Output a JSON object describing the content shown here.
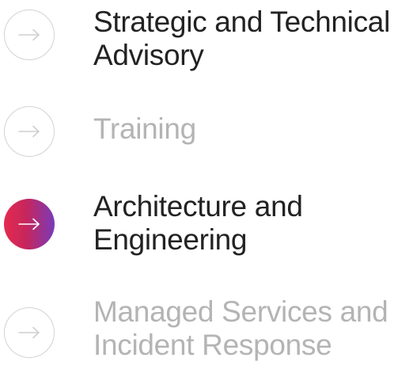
{
  "services": [
    {
      "lines": [
        "Strategic and Technical",
        "Advisory"
      ],
      "state": "default",
      "icon": "arrow-right-icon"
    },
    {
      "lines": [
        "Training"
      ],
      "state": "muted",
      "icon": "arrow-right-icon"
    },
    {
      "lines": [
        "Architecture and",
        "Engineering"
      ],
      "state": "active",
      "icon": "arrow-right-icon"
    },
    {
      "lines": [
        "Managed Services and",
        "Incident Response"
      ],
      "state": "muted",
      "icon": "arrow-right-icon"
    }
  ],
  "colors": {
    "text_dark": "#222222",
    "text_muted": "#b4b4b4",
    "outline": "#d3d3d3",
    "accent_start": "#e52a4d",
    "accent_end": "#7a3ab8"
  }
}
